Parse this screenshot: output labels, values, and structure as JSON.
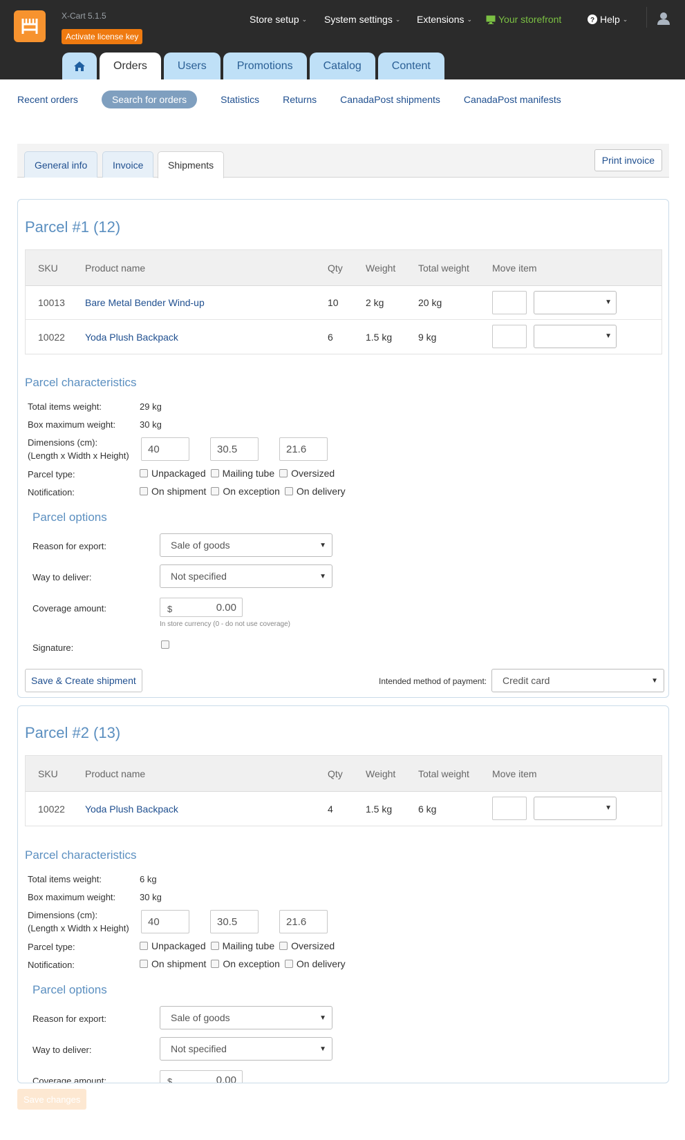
{
  "header": {
    "version": "X-Cart 5.1.5",
    "license_button": "Activate license key",
    "nav": [
      {
        "label": "Store setup"
      },
      {
        "label": "System settings"
      },
      {
        "label": "Extensions"
      },
      {
        "label": "Your storefront"
      },
      {
        "label": "Help"
      }
    ],
    "main_tabs": [
      "Orders",
      "Users",
      "Promotions",
      "Catalog",
      "Content"
    ],
    "active_tab": "Orders",
    "icons": {
      "home": "home-icon",
      "user": "user-icon",
      "help": "help-circle-icon",
      "storefront": "monitor-icon"
    },
    "colors": {
      "header_bg": "#2b2b2b",
      "logo": "#f7932f",
      "license": "#ef7a10",
      "tab_bg": "#bfe0f7",
      "storefront": "#7bc043"
    }
  },
  "subnav": {
    "items": [
      "Recent orders",
      "Search for orders",
      "Statistics",
      "Returns",
      "CanadaPost shipments",
      "CanadaPost manifests"
    ],
    "active": "Search for orders"
  },
  "order_tabs": {
    "items": [
      "General info",
      "Invoice",
      "Shipments"
    ],
    "active": "Shipments",
    "print_button": "Print invoice"
  },
  "table_headers": [
    "SKU",
    "Product name",
    "Qty",
    "Weight",
    "Total weight",
    "Move item"
  ],
  "labels": {
    "characteristics_title": "Parcel characteristics",
    "total_weight": "Total items weight:",
    "box_max_weight": "Box maximum weight:",
    "dimensions": "Dimensions (cm):",
    "dimensions_sub": "(Length x Width x Height)",
    "parcel_type": "Parcel type:",
    "notification": "Notification:",
    "unpackaged": "Unpackaged",
    "mailing_tube": "Mailing tube",
    "oversized": "Oversized",
    "on_shipment": "On shipment",
    "on_exception": "On exception",
    "on_delivery": "On delivery",
    "options_title": "Parcel options",
    "reason": "Reason for export:",
    "way": "Way to deliver:",
    "coverage": "Coverage amount:",
    "coverage_hint": "In store currency (0 - do not use coverage)",
    "signature": "Signature:",
    "save_create": "Save & Create shipment",
    "payment_label": "Intended method of payment:",
    "currency": "$"
  },
  "parcels": [
    {
      "title": "Parcel #1 (12)",
      "items": [
        {
          "sku": "10013",
          "name": "Bare Metal Bender Wind-up",
          "qty": "10",
          "weight": "2 kg",
          "total": "20 kg"
        },
        {
          "sku": "10022",
          "name": "Yoda Plush Backpack",
          "qty": "6",
          "weight": "1.5 kg",
          "total": "9 kg"
        }
      ],
      "total_weight": "29 kg",
      "box_max": "30 kg",
      "dims": [
        "40",
        "30.5",
        "21.6"
      ],
      "reason": "Sale of goods",
      "way": "Not specified",
      "coverage": "0.00",
      "payment": "Credit card"
    },
    {
      "title": "Parcel #2 (13)",
      "items": [
        {
          "sku": "10022",
          "name": "Yoda Plush Backpack",
          "qty": "4",
          "weight": "1.5 kg",
          "total": "6 kg"
        }
      ],
      "total_weight": "6 kg",
      "box_max": "30 kg",
      "dims": [
        "40",
        "30.5",
        "21.6"
      ],
      "reason": "Sale of goods",
      "way": "Not specified",
      "coverage": "0.00"
    }
  ],
  "save_changes": "Save changes"
}
